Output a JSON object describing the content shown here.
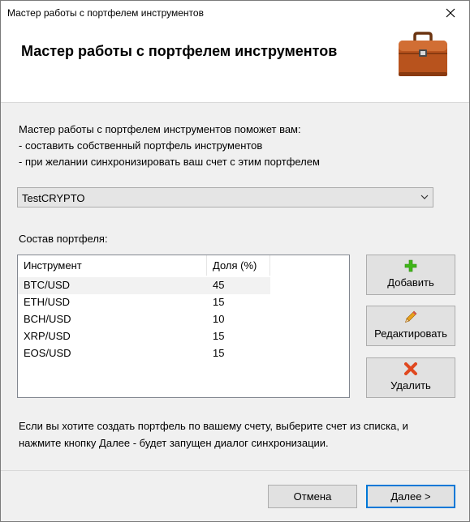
{
  "window": {
    "title": "Мастер работы с портфелем инструментов"
  },
  "header": {
    "heading": "Мастер работы с портфелем инструментов",
    "icon": "briefcase-icon"
  },
  "intro": {
    "line1": "Мастер работы с портфелем инструментов поможет вам:",
    "line2": "- составить собственный портфель инструментов",
    "line3": "- при желании синхронизировать ваш счет с этим портфелем"
  },
  "portfolio_select": {
    "value": "TestCRYPTO"
  },
  "composition": {
    "label": "Состав портфеля:",
    "columns": [
      "Инструмент",
      "Доля (%)"
    ],
    "rows": [
      {
        "instrument": "BTC/USD",
        "share": "45"
      },
      {
        "instrument": "ETH/USD",
        "share": "15"
      },
      {
        "instrument": "BCH/USD",
        "share": "10"
      },
      {
        "instrument": "XRP/USD",
        "share": "15"
      },
      {
        "instrument": "EOS/USD",
        "share": "15"
      }
    ],
    "selected_row": 0
  },
  "actions": {
    "add": "Добавить",
    "edit": "Редактировать",
    "delete": "Удалить"
  },
  "footer": {
    "line1": "Если вы хотите создать портфель по вашему счету, выберите счет из списка, и",
    "line2": "нажмите кнопку Далее - будет запущен диалог синхронизации."
  },
  "buttons": {
    "cancel": "Отмена",
    "next": "Далее >"
  },
  "colors": {
    "accent": "#0078d7",
    "add_icon": "#3fb618",
    "delete_icon": "#e0481f",
    "briefcase": "#b8531d"
  }
}
